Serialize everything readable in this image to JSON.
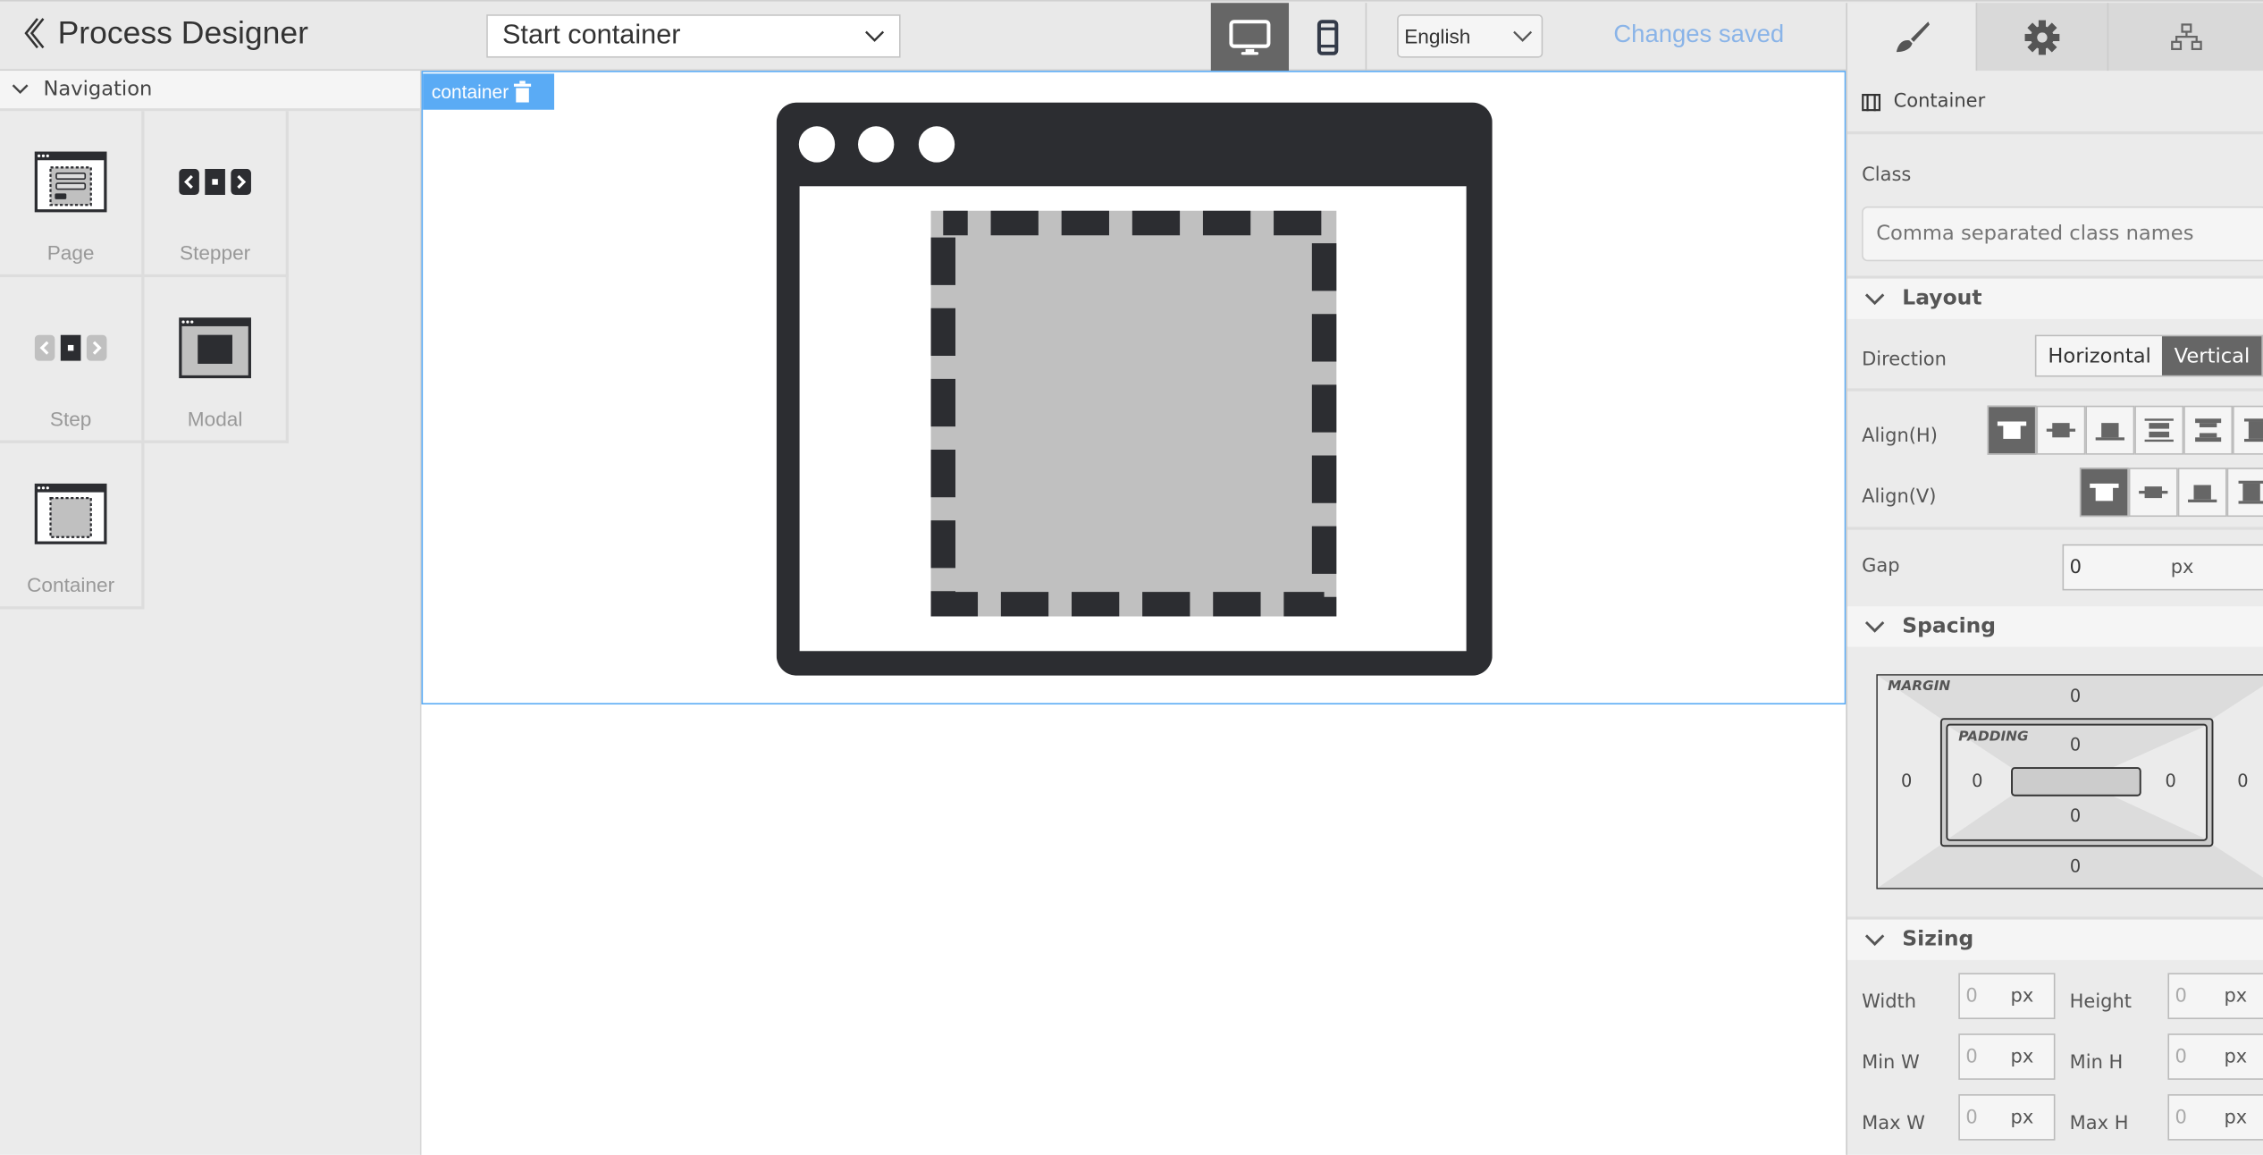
{
  "header": {
    "title": "Process Designer",
    "back_icon": "chevron-left-icon",
    "page_select": {
      "value": "Start container"
    },
    "devices": [
      {
        "name": "desktop",
        "active": true
      },
      {
        "name": "mobile",
        "active": false
      }
    ],
    "language_select": {
      "value": "English"
    },
    "save_status": "Changes saved",
    "save_status_color": "#8ab4e8",
    "panel_tabs": [
      {
        "icon": "brush-icon",
        "active": true
      },
      {
        "icon": "gear-icon",
        "active": false
      },
      {
        "icon": "sitemap-icon",
        "active": false
      }
    ]
  },
  "sidebar": {
    "section": "Navigation",
    "items": [
      {
        "label": "Page"
      },
      {
        "label": "Stepper"
      },
      {
        "label": "Step"
      },
      {
        "label": "Modal"
      },
      {
        "label": "Container"
      }
    ]
  },
  "canvas": {
    "selected_label": "container",
    "selection_color": "#5aabf5"
  },
  "properties": {
    "element_type": "Container",
    "class_label": "Class",
    "class_placeholder": "Comma separated class names",
    "layout": {
      "title": "Layout",
      "direction_label": "Direction",
      "direction_options": [
        "Horizontal",
        "Vertical"
      ],
      "direction_selected": "Vertical",
      "align_h_label": "Align(H)",
      "align_h_selected": 0,
      "align_v_label": "Align(V)",
      "align_v_selected": 0,
      "gap_label": "Gap",
      "gap_value": "0",
      "unit": "px"
    },
    "spacing": {
      "title": "Spacing",
      "margin_label": "MARGIN",
      "padding_label": "PADDING",
      "margin": {
        "top": "0",
        "right": "0",
        "bottom": "0",
        "left": "0"
      },
      "padding": {
        "top": "0",
        "right": "0",
        "bottom": "0",
        "left": "0"
      }
    },
    "sizing": {
      "title": "Sizing",
      "fields": [
        {
          "label": "Width",
          "placeholder": "0",
          "unit": "px"
        },
        {
          "label": "Height",
          "placeholder": "0",
          "unit": "px"
        },
        {
          "label": "Min W",
          "placeholder": "0",
          "unit": "px"
        },
        {
          "label": "Min H",
          "placeholder": "0",
          "unit": "px"
        },
        {
          "label": "Max W",
          "placeholder": "0",
          "unit": "px"
        },
        {
          "label": "Max H",
          "placeholder": "0",
          "unit": "px"
        }
      ]
    }
  }
}
